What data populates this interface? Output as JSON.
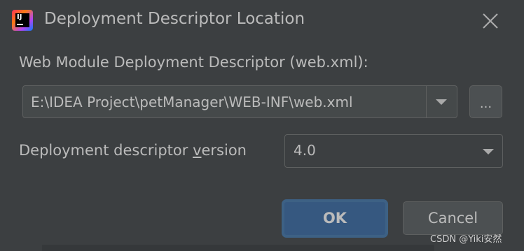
{
  "window": {
    "title": "Deployment Descriptor Location",
    "app_icon": "intellij-idea-logo",
    "app_icon_text": "IJ"
  },
  "descriptor": {
    "label": "Web Module Deployment Descriptor (web.xml):",
    "path_value": "E:\\IDEA Project\\petManager\\WEB-INF\\web.xml",
    "browse_label": "..."
  },
  "version": {
    "label_before": "Deployment descriptor ",
    "label_mnemonic": "v",
    "label_after": "ersion",
    "selected": "4.0"
  },
  "buttons": {
    "ok": "OK",
    "cancel": "Cancel"
  },
  "watermark": "CSDN @Yiki安然",
  "colors": {
    "background": "#3c3f41",
    "text": "#bbbbbb",
    "primary_button": "#365880",
    "border": "#5e6060"
  }
}
